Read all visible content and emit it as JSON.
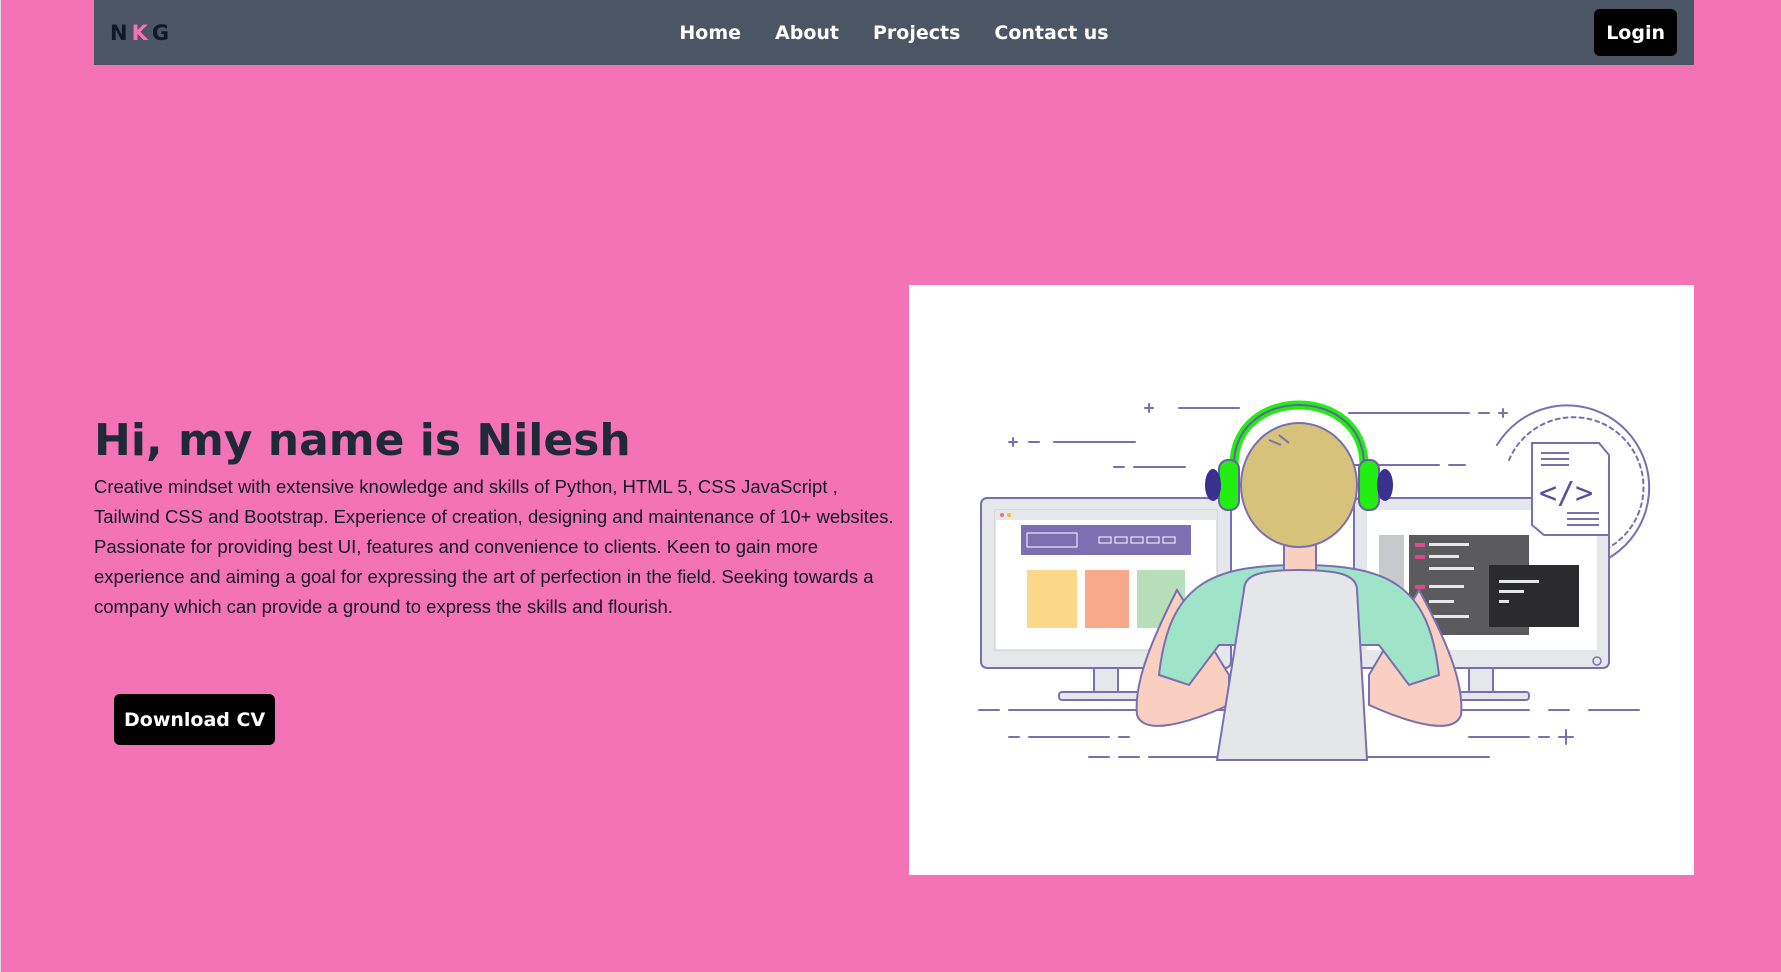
{
  "nav": {
    "logo": {
      "n": "N",
      "k": "K",
      "g": "G"
    },
    "links": [
      "Home",
      "About",
      "Projects",
      "Contact us"
    ],
    "login_label": "Login"
  },
  "hero": {
    "title": "Hi, my name is Nilesh",
    "description": "Creative mindset with extensive knowledge and skills of Python, HTML 5, CSS JavaScript , Tailwind CSS and Bootstrap. Experience of creation, designing and maintenance of 10+ websites. Passionate for providing best UI, features and convenience to clients. Keen to gain more experience and aiming a goal for expressing the art of perfection in the field. Seeking towards a company which can provide a ground to express the skills and flourish.",
    "download_label": "Download CV",
    "code_symbol": "</>"
  },
  "colors": {
    "page_background": "#f472b6",
    "navbar": "#4b5563",
    "button": "#000000",
    "headphones": "#22ee11"
  },
  "icons": {
    "illustration": "developer-at-desk-illustration"
  }
}
